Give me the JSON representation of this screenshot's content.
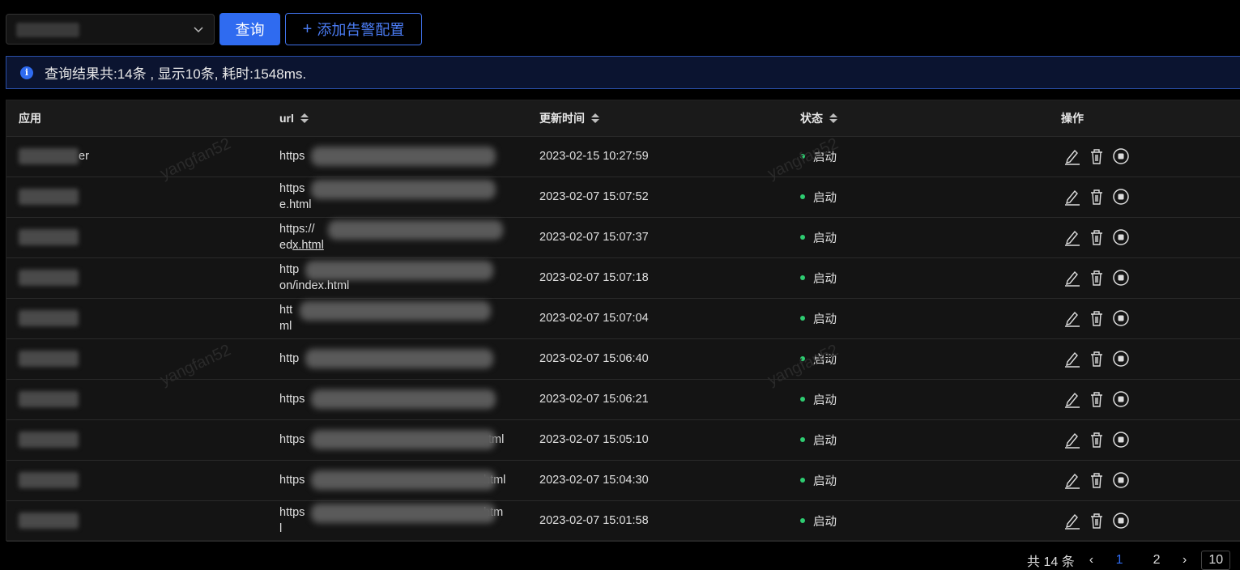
{
  "toolbar": {
    "select_value": "",
    "query_label": "查询",
    "add_label": "添加告警配置"
  },
  "alert": {
    "message": "查询结果共:14条 , 显示10条, 耗时:1548ms."
  },
  "table": {
    "headers": {
      "app": "应用",
      "url": "url",
      "updated": "更新时间",
      "status": "状态",
      "actions": "操作"
    },
    "rows": [
      {
        "app": "er",
        "url1": "https",
        "url2": "",
        "time": "2023-02-15 10:27:59",
        "status": "启动"
      },
      {
        "app": "",
        "url1": "https",
        "url2": "e.html",
        "time": "2023-02-07 15:07:52",
        "status": "启动"
      },
      {
        "app": "",
        "url1": "https://",
        "url2": "ed",
        "url2b": "x.html",
        "time": "2023-02-07 15:07:37",
        "status": "启动"
      },
      {
        "app": "",
        "url1": "http",
        "url2": "on/index.html",
        "time": "2023-02-07 15:07:18",
        "status": "启动"
      },
      {
        "app": "",
        "url1": "htt",
        "url2": "ml",
        "time": "2023-02-07 15:07:04",
        "status": "启动"
      },
      {
        "app": "",
        "url1": "http",
        "url2": "",
        "time": "2023-02-07 15:06:40",
        "status": "启动"
      },
      {
        "app": "",
        "url1": "https",
        "url2": "",
        "time": "2023-02-07 15:06:21",
        "status": "启动"
      },
      {
        "app": "",
        "url1": "https",
        "url1b": "tml",
        "url2": "",
        "time": "2023-02-07 15:05:10",
        "status": "启动"
      },
      {
        "app": "",
        "url1": "https",
        "url1b": "html",
        "url2": "",
        "time": "2023-02-07 15:04:30",
        "status": "启动"
      },
      {
        "app": "",
        "url1": "https",
        "url1b": "htm",
        "url2": "l",
        "time": "2023-02-07 15:01:58",
        "status": "启动"
      }
    ]
  },
  "watermark": "yangfan52",
  "pager": {
    "total": "共 14 条",
    "pages": [
      "1",
      "2"
    ],
    "current": "1",
    "size": "10"
  },
  "colors": {
    "primary": "#2f6bf0",
    "status_ok": "#2ecc71",
    "background": "#000000",
    "table_bg": "#141414"
  },
  "icons": [
    "chevron-down-icon",
    "plus-icon",
    "info-icon",
    "sort-icon",
    "edit-icon",
    "delete-icon",
    "stop-icon",
    "prev-icon",
    "next-icon"
  ]
}
